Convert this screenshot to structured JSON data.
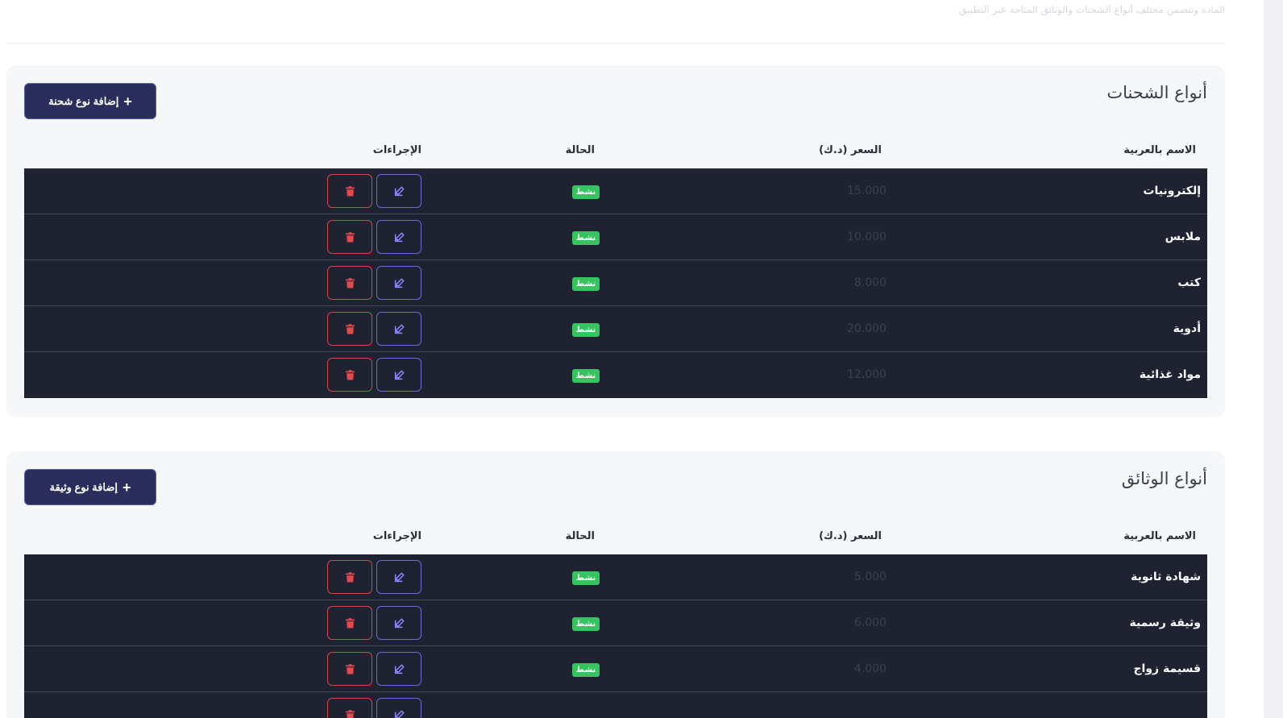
{
  "header": {
    "description": "المادة وتتضمن مختلف أنواع الشحنات والوثائق المتاحة عبر التطبيق"
  },
  "shipment_types": {
    "title": "أنواع الشحنات",
    "add_button": "إضافة نوع شحنة",
    "columns": {
      "name": "الاسم بالعربية",
      "price": "السعر (د.ك)",
      "status": "الحالة",
      "actions": "الإجراءات"
    },
    "rows": [
      {
        "name": "إلكترونيات",
        "price": "15.000",
        "status": "نشط"
      },
      {
        "name": "ملابس",
        "price": "10.000",
        "status": "نشط"
      },
      {
        "name": "كتب",
        "price": "8.000",
        "status": "نشط"
      },
      {
        "name": "أدوية",
        "price": "20.000",
        "status": "نشط"
      },
      {
        "name": "مواد غذائية",
        "price": "12.000",
        "status": "نشط"
      }
    ]
  },
  "document_types": {
    "title": "أنواع الوثائق",
    "add_button": "إضافة نوع وثيقة",
    "columns": {
      "name": "الاسم بالعربية",
      "price": "السعر (د.ك)",
      "status": "الحالة",
      "actions": "الإجراءات"
    },
    "rows": [
      {
        "name": "شهادة ثانوية",
        "price": "5.000",
        "status": "نشط"
      },
      {
        "name": "وثيقة رسمية",
        "price": "6.000",
        "status": "نشط"
      },
      {
        "name": "قسيمة زواج",
        "price": "4.000",
        "status": "نشط"
      }
    ],
    "partial_rows": 1
  },
  "icons": {
    "edit": "edit-icon",
    "delete": "trash-icon",
    "add": "plus-icon"
  },
  "colors": {
    "primary": "#2b2d5c",
    "row_bg": "#1e2231",
    "active_badge": "#37c35f",
    "edit_border": "#6f6bd6",
    "delete_border": "#d0474e"
  }
}
